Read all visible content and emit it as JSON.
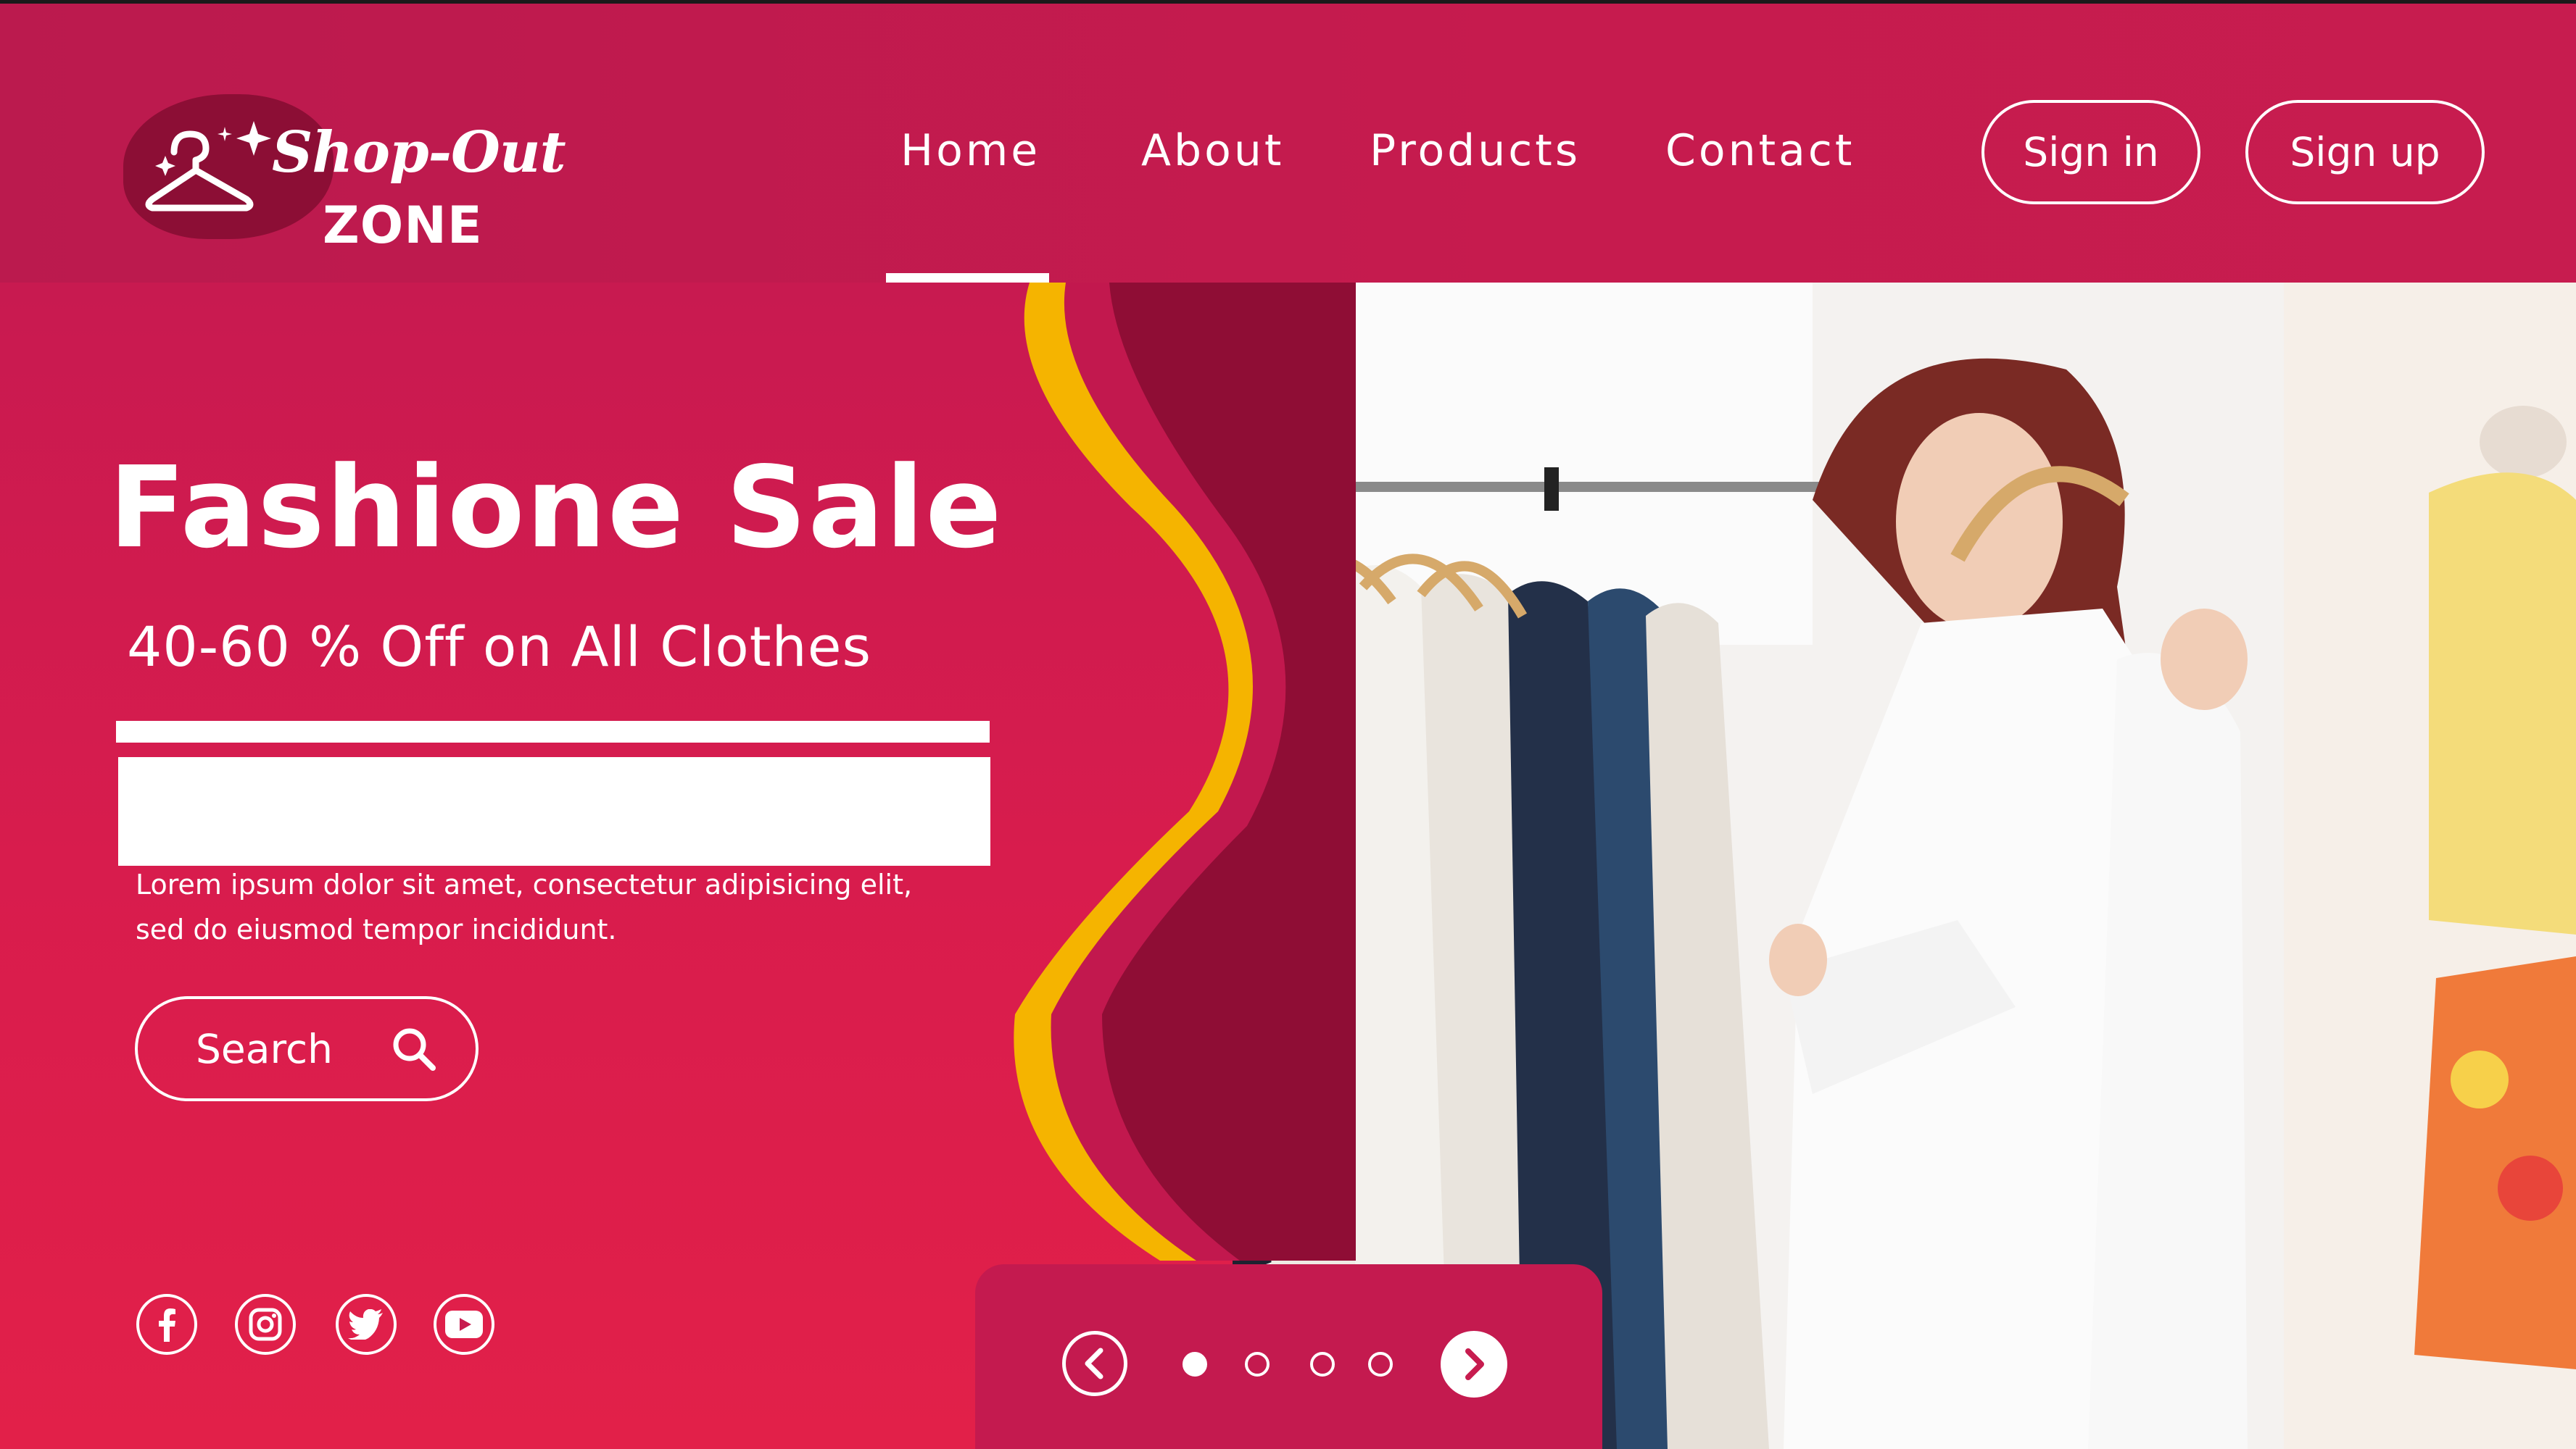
{
  "brand": {
    "name_script": "Shop-Out",
    "name_block": "ZONE"
  },
  "nav": {
    "items": [
      {
        "label": "Home",
        "active": true
      },
      {
        "label": "About",
        "active": false
      },
      {
        "label": "Products",
        "active": false
      },
      {
        "label": "Contact",
        "active": false
      }
    ]
  },
  "auth": {
    "sign_in": "Sign in",
    "sign_up": "Sign up"
  },
  "hero": {
    "title": "Fashione Sale",
    "subtitle": "40-60 % Off on All Clothes",
    "description": "Lorem ipsum dolor sit amet, consectetur adipisicing elit, sed do eiusmod tempor incididunt.",
    "search_label": "Search"
  },
  "social": {
    "icons": [
      "facebook-icon",
      "instagram-icon",
      "twitter-icon",
      "youtube-icon"
    ]
  },
  "slider": {
    "total_slides": 4,
    "current_slide": 1
  },
  "colors": {
    "brand_primary": "#c71c4f",
    "brand_dark": "#8c0e35",
    "accent_yellow": "#f5b400",
    "white": "#ffffff"
  }
}
